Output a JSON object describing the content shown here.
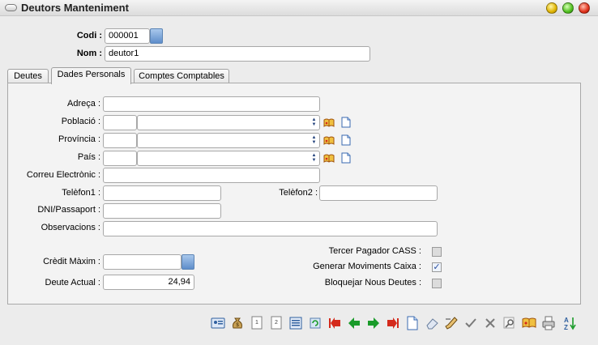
{
  "window": {
    "title": "Deutors Manteniment",
    "buttons": [
      "minimize-icon",
      "maximize-icon",
      "close-icon"
    ]
  },
  "header": {
    "codi_label": "Codi :",
    "codi_value": "000001",
    "nom_label": "Nom :",
    "nom_value": "deutor1"
  },
  "tabs": [
    {
      "label": "Deutes",
      "active": false
    },
    {
      "label": "Dades Personals",
      "active": true
    },
    {
      "label": "Comptes Comptables",
      "active": false
    }
  ],
  "form": {
    "adreca_label": "Adreça :",
    "adreca_value": "",
    "poblacio_label": "Població :",
    "provincia_label": "Província :",
    "pais_label": "País :",
    "correu_label": "Correu Electrònic :",
    "telefon1_label": "Telèfon1 :",
    "telefon2_label": "Telèfon2 :",
    "dni_label": "DNI/Passaport :",
    "observacions_label": "Observacions :",
    "credit_label": "Crèdit Màxim :",
    "credit_value": "",
    "deute_label": "Deute Actual :",
    "deute_value": "24,94"
  },
  "options": {
    "tercer_label": "Tercer Pagador CASS :",
    "tercer_checked": false,
    "generar_label": "Generar Moviments Caixa :",
    "generar_checked": true,
    "bloquejar_label": "Bloquejar Nous Deutes :",
    "bloquejar_checked": false
  },
  "toolbar": [
    "id-card-icon",
    "money-bag-icon",
    "page-1-icon",
    "page-2-icon",
    "list-icon",
    "refresh-icon",
    "first-record-icon",
    "previous-record-icon",
    "next-record-icon",
    "last-record-icon",
    "new-document-icon",
    "eraser-icon",
    "edit-icon",
    "confirm-icon",
    "cancel-icon",
    "search-icon",
    "book-icon",
    "print-icon",
    "sort-az-icon"
  ],
  "colors": {
    "background": "#ececec",
    "panel": "#f3f3f3",
    "accent_blue": "#5e8dca",
    "arrow_red": "#d42a1c",
    "arrow_green": "#1a9b2a"
  }
}
